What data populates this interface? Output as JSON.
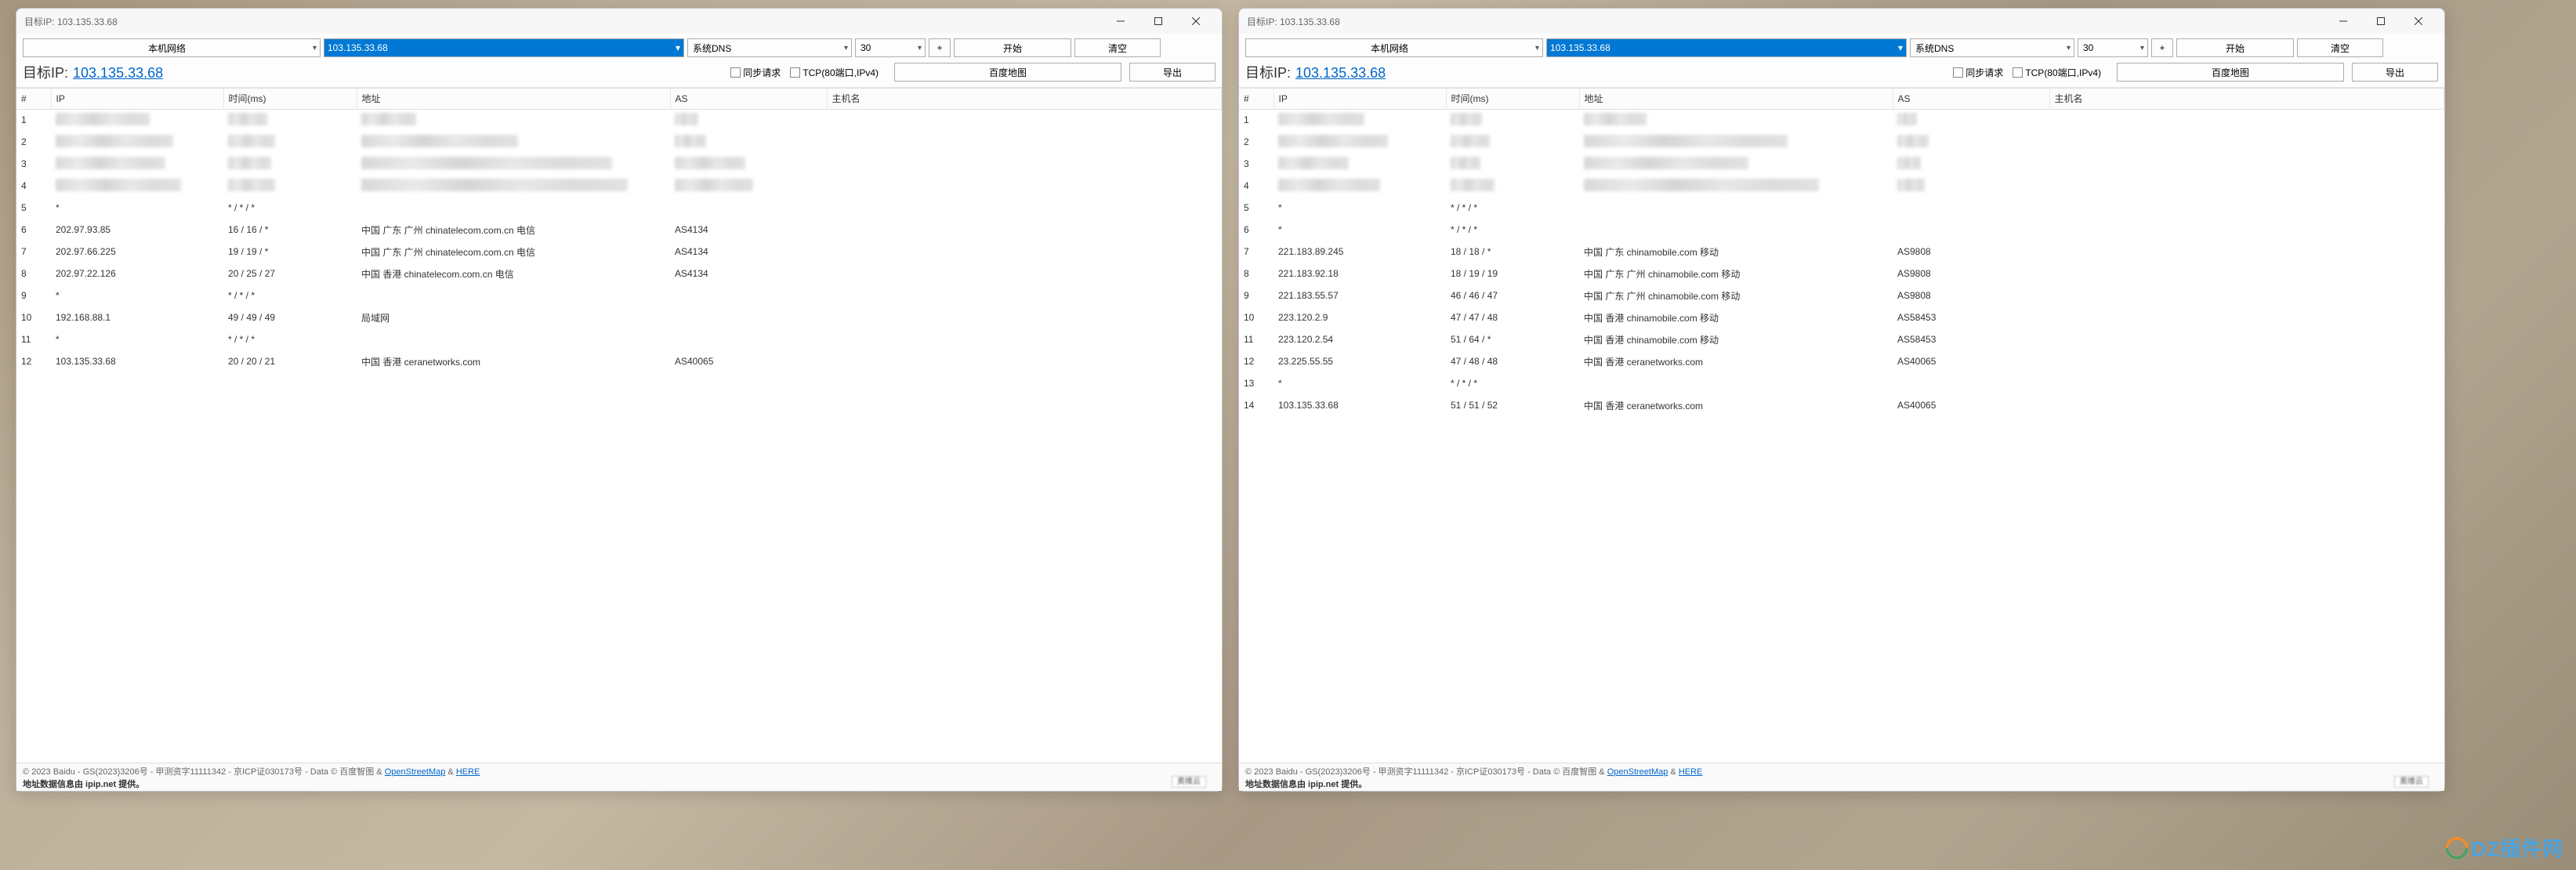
{
  "left": {
    "title": "目标IP: 103.135.33.68",
    "network_label": "本机网络",
    "ip_input": "103.135.33.68",
    "dns_label": "系统DNS",
    "count": "30",
    "plus": "+",
    "start": "开始",
    "clear": "清空",
    "target_prefix": "目标IP:",
    "target_ip": "103.135.33.68",
    "chk_sync": "同步请求",
    "chk_tcp": "TCP(80端口,IPv4)",
    "baidu_map": "百度地图",
    "export": "导出",
    "headers": {
      "idx": "#",
      "ip": "IP",
      "time": "时间(ms)",
      "addr": "地址",
      "as": "AS",
      "host": "主机名"
    },
    "rows": [
      {
        "idx": "1",
        "blurred": true,
        "ipw": 120,
        "tw": 50,
        "aw": 70,
        "sw": 30
      },
      {
        "idx": "2",
        "blurred": true,
        "ipw": 150,
        "tw": 60,
        "aw": 200,
        "sw": 40
      },
      {
        "idx": "3",
        "blurred": true,
        "ipw": 140,
        "tw": 55,
        "aw": 320,
        "sw": 90
      },
      {
        "idx": "4",
        "blurred": true,
        "ipw": 160,
        "tw": 60,
        "aw": 340,
        "sw": 100
      },
      {
        "idx": "5",
        "ip": "*",
        "time": "* / * / *",
        "addr": "",
        "as": "",
        "host": ""
      },
      {
        "idx": "6",
        "ip": "202.97.93.85",
        "time": "16 / 16 / *",
        "addr": "中国 广东 广州 chinatelecom.com.cn 电信",
        "as": "AS4134",
        "host": ""
      },
      {
        "idx": "7",
        "ip": "202.97.66.225",
        "time": "19 / 19 / *",
        "addr": "中国 广东 广州 chinatelecom.com.cn 电信",
        "as": "AS4134",
        "host": ""
      },
      {
        "idx": "8",
        "ip": "202.97.22.126",
        "time": "20 / 25 / 27",
        "addr": "中国 香港 chinatelecom.com.cn 电信",
        "as": "AS4134",
        "host": ""
      },
      {
        "idx": "9",
        "ip": "*",
        "time": "* / * / *",
        "addr": "",
        "as": "",
        "host": ""
      },
      {
        "idx": "10",
        "ip": "192.168.88.1",
        "time": "49 / 49 / 49",
        "addr": "局域网",
        "as": "",
        "host": ""
      },
      {
        "idx": "11",
        "ip": "*",
        "time": "* / * / *",
        "addr": "",
        "as": "",
        "host": ""
      },
      {
        "idx": "12",
        "ip": "103.135.33.68",
        "time": "20 / 20 / 21",
        "addr": "中国 香港 ceranetworks.com",
        "as": "AS40065",
        "host": ""
      }
    ],
    "copyright": "© 2023 Baidu - GS(2023)3206号 - 甲测资字11111342 - 京ICP证030173号 - Data © 百度智图 &",
    "osm": "OpenStreetMap",
    "amp": " & ",
    "here": "HERE",
    "source": "地址数据信息由 ipip.net 提供。",
    "aocp": "奥维云"
  },
  "right": {
    "title": "目标IP: 103.135.33.68",
    "network_label": "本机网络",
    "ip_input": "103.135.33.68",
    "dns_label": "系统DNS",
    "count": "30",
    "plus": "+",
    "start": "开始",
    "clear": "清空",
    "target_prefix": "目标IP:",
    "target_ip": "103.135.33.68",
    "chk_sync": "同步请求",
    "chk_tcp": "TCP(80端口,IPv4)",
    "baidu_map": "百度地图",
    "export": "导出",
    "headers": {
      "idx": "#",
      "ip": "IP",
      "time": "时间(ms)",
      "addr": "地址",
      "as": "AS",
      "host": "主机名"
    },
    "rows": [
      {
        "idx": "1",
        "blurred": true,
        "ipw": 110,
        "tw": 40,
        "aw": 80,
        "sw": 25
      },
      {
        "idx": "2",
        "blurred": true,
        "ipw": 140,
        "tw": 50,
        "aw": 260,
        "sw": 40
      },
      {
        "idx": "3",
        "blurred": true,
        "ipw": 90,
        "tw": 38,
        "aw": 210,
        "sw": 30
      },
      {
        "idx": "4",
        "blurred": true,
        "ipw": 130,
        "tw": 56,
        "aw": 300,
        "sw": 35
      },
      {
        "idx": "5",
        "ip": "*",
        "time": "* / * / *",
        "addr": "",
        "as": "",
        "host": ""
      },
      {
        "idx": "6",
        "ip": "*",
        "time": "* / * / *",
        "addr": "",
        "as": "",
        "host": ""
      },
      {
        "idx": "7",
        "ip": "221.183.89.245",
        "time": "18 / 18 / *",
        "addr": "中国 广东 chinamobile.com 移动",
        "as": "AS9808",
        "host": ""
      },
      {
        "idx": "8",
        "ip": "221.183.92.18",
        "time": "18 / 19 / 19",
        "addr": "中国 广东 广州 chinamobile.com 移动",
        "as": "AS9808",
        "host": ""
      },
      {
        "idx": "9",
        "ip": "221.183.55.57",
        "time": "46 / 46 / 47",
        "addr": "中国 广东 广州 chinamobile.com 移动",
        "as": "AS9808",
        "host": ""
      },
      {
        "idx": "10",
        "ip": "223.120.2.9",
        "time": "47 / 47 / 48",
        "addr": "中国 香港 chinamobile.com 移动",
        "as": "AS58453",
        "host": ""
      },
      {
        "idx": "11",
        "ip": "223.120.2.54",
        "time": "51 / 64 / *",
        "addr": "中国 香港 chinamobile.com 移动",
        "as": "AS58453",
        "host": ""
      },
      {
        "idx": "12",
        "ip": "23.225.55.55",
        "time": "47 / 48 / 48",
        "addr": "中国 香港 ceranetworks.com",
        "as": "AS40065",
        "host": ""
      },
      {
        "idx": "13",
        "ip": "*",
        "time": "* / * / *",
        "addr": "",
        "as": "",
        "host": ""
      },
      {
        "idx": "14",
        "ip": "103.135.33.68",
        "time": "51 / 51 / 52",
        "addr": "中国 香港 ceranetworks.com",
        "as": "AS40065",
        "host": ""
      }
    ],
    "copyright": "© 2023 Baidu - GS(2023)3206号 - 甲测资字11111342 - 京ICP证030173号 - Data © 百度智图 &",
    "osm": "OpenStreetMap",
    "amp": " & ",
    "here": "HERE",
    "source": "地址数据信息由 ipip.net 提供。",
    "aocp": "奥维云"
  },
  "dz_badge": "DZ插件网"
}
